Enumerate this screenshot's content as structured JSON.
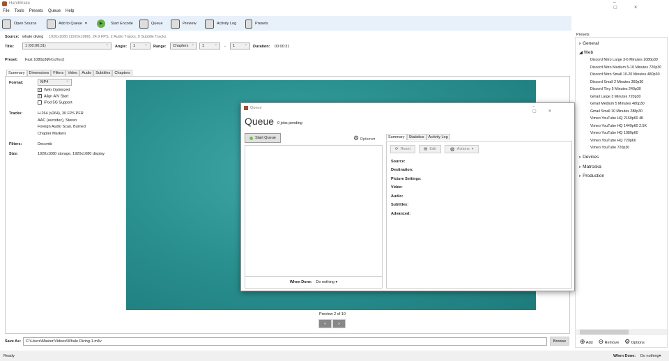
{
  "app": {
    "title": "HandBrake"
  },
  "menu": [
    "File",
    "Tools",
    "Presets",
    "Queue",
    "Help"
  ],
  "toolbar": {
    "open_source": "Open Source",
    "add_to_queue": "Add to Queue",
    "start_encode": "Start Encode",
    "queue": "Queue",
    "preview": "Preview",
    "activity_log": "Activity Log",
    "presets": "Presets"
  },
  "source": {
    "label": "Source:",
    "name": "whale diving",
    "info": "1920x1080 (1920x1080), 24.9 FPS, 2 Audio Tracks, 0 Subtitle Tracks"
  },
  "title_row": {
    "title_label": "Title:",
    "title_value": "1 (00:00:31)",
    "angle_label": "Angle:",
    "angle_value": "1",
    "range_label": "Range:",
    "range_type": "Chapters",
    "range_start": "1",
    "range_sep": "-",
    "range_end": "1",
    "duration_label": "Duration:",
    "duration_value": "00:00:31"
  },
  "preset": {
    "label": "Preset:",
    "name": "Fast 1080p30",
    "modified": "(Modified)"
  },
  "tabs": [
    "Summary",
    "Dimensions",
    "Filters",
    "Video",
    "Audio",
    "Subtitles",
    "Chapters"
  ],
  "summary": {
    "format_label": "Format:",
    "format_value": "MP4",
    "web_optimized": "Web Optimized",
    "align_av": "Align A/V Start",
    "ipod": "iPod 5G Support",
    "tracks_label": "Tracks:",
    "tracks": [
      "H.264 (x264), 30 FPS PFR",
      "AAC (avcodec), Stereo",
      "Foreign Audio Scan, Burned",
      "Chapter Markers"
    ],
    "filters_label": "Filters:",
    "filters_value": "Decomb",
    "size_label": "Size:",
    "size_value": "1920x1080 storage, 1920x1080 display"
  },
  "preview": {
    "label": "Preview 2 of 10",
    "prev": "<",
    "next": ">"
  },
  "save": {
    "label": "Save As:",
    "path": "C:\\Users\\Master\\Videos\\Whale Diving-1.m4v",
    "browse": "Browse"
  },
  "status": {
    "text": "Ready",
    "when_done_label": "When Done:",
    "when_done_value": "Do nothing"
  },
  "presets_pane": {
    "title": "Presets",
    "categories": [
      "General",
      "Web",
      "Devices",
      "Matroska",
      "Production"
    ],
    "web_items": [
      "Discord Nitro Large 3-6 Minutes 1080p30",
      "Discord Nitro Medium 5-10 Minutes 720p30",
      "Discord Nitro Small 10-20 Minutes 480p30",
      "Discord Small 2 Minutes 360p30",
      "Discord Tiny 5 Minutes 240p30",
      "Gmail Large 3 Minutes 720p30",
      "Gmail Medium 5 Minutes 480p30",
      "Gmail Small 10 Minutes 288p30",
      "Vimeo YouTube HQ 2160p60 4K",
      "Vimeo YouTube HQ 1440p60 2.5K",
      "Vimeo YouTube HQ 1080p60",
      "Vimeo YouTube HQ 720p60",
      "Vimeo YouTube 720p30"
    ],
    "add": "Add",
    "remove": "Remove",
    "options": "Options"
  },
  "queue_window": {
    "title": "Queue",
    "heading": "Queue",
    "pending": "0 jobs pending",
    "start_queue": "Start Queue",
    "options": "Options",
    "tabs": [
      "Summary",
      "Statistics",
      "Activity Log"
    ],
    "reset": "Reset",
    "edit": "Edit",
    "actions": "Actions",
    "fields": [
      "Source:",
      "Destination:",
      "Picture Settings:",
      "Video:",
      "Audio:",
      "Subtitles:",
      "Advanced:"
    ],
    "when_done_label": "When Done:",
    "when_done_value": "Do nothing"
  }
}
